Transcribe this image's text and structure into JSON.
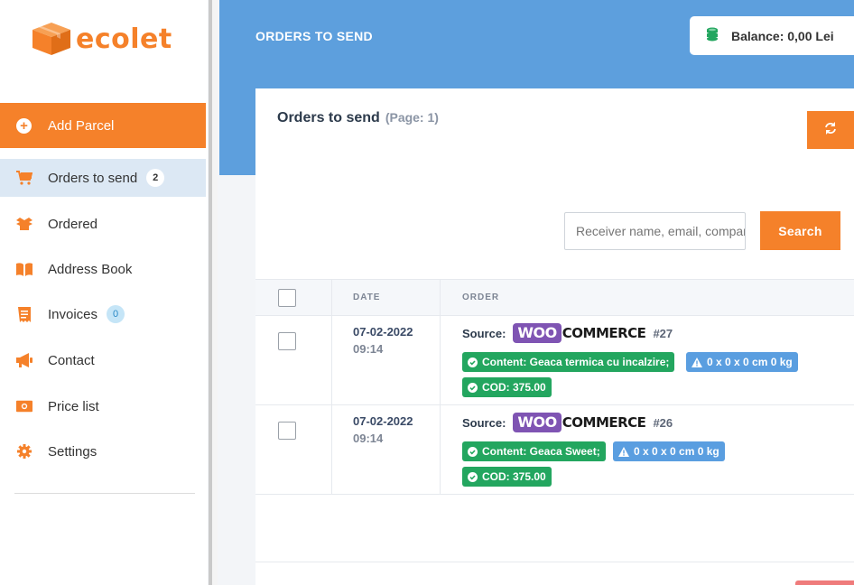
{
  "brand": {
    "name": "ecolet",
    "color": "#f5812a"
  },
  "sidebar": {
    "add_parcel": "Add Parcel",
    "items": [
      {
        "label": "Orders to send",
        "icon": "cart-icon",
        "badge": "2",
        "active": true
      },
      {
        "label": "Ordered",
        "icon": "box-icon"
      },
      {
        "label": "Address Book",
        "icon": "book-icon"
      },
      {
        "label": "Invoices",
        "icon": "invoice-icon",
        "badge": "0"
      },
      {
        "label": "Contact",
        "icon": "megaphone-icon"
      },
      {
        "label": "Price list",
        "icon": "money-icon"
      },
      {
        "label": "Settings",
        "icon": "gear-icon"
      }
    ]
  },
  "header": {
    "title": "ORDERS TO SEND",
    "balance": "Balance: 0,00 Lei",
    "color": "#5d9fdd"
  },
  "card": {
    "title": "Orders to send",
    "page": "(Page: 1)",
    "search_placeholder": "Receiver name, email, company",
    "search_button": "Search"
  },
  "table": {
    "columns": [
      "DATE",
      "ORDER"
    ],
    "rows": [
      {
        "date": "07-02-2022",
        "time": "09:14",
        "source_label": "Source:",
        "platform": {
          "box": "WOO",
          "text": "COMMERCE"
        },
        "order_number": "#27",
        "content": "Content: Geaca termica cu incalzire;",
        "dimensions": "0 x 0 x 0 cm 0 kg",
        "cod": "COD: 375.00"
      },
      {
        "date": "07-02-2022",
        "time": "09:14",
        "source_label": "Source:",
        "platform": {
          "box": "WOO",
          "text": "COMMERCE"
        },
        "order_number": "#26",
        "content": "Content: Geaca Sweet;",
        "dimensions": "0 x 0 x 0 cm 0 kg",
        "cod": "COD: 375.00"
      }
    ]
  }
}
